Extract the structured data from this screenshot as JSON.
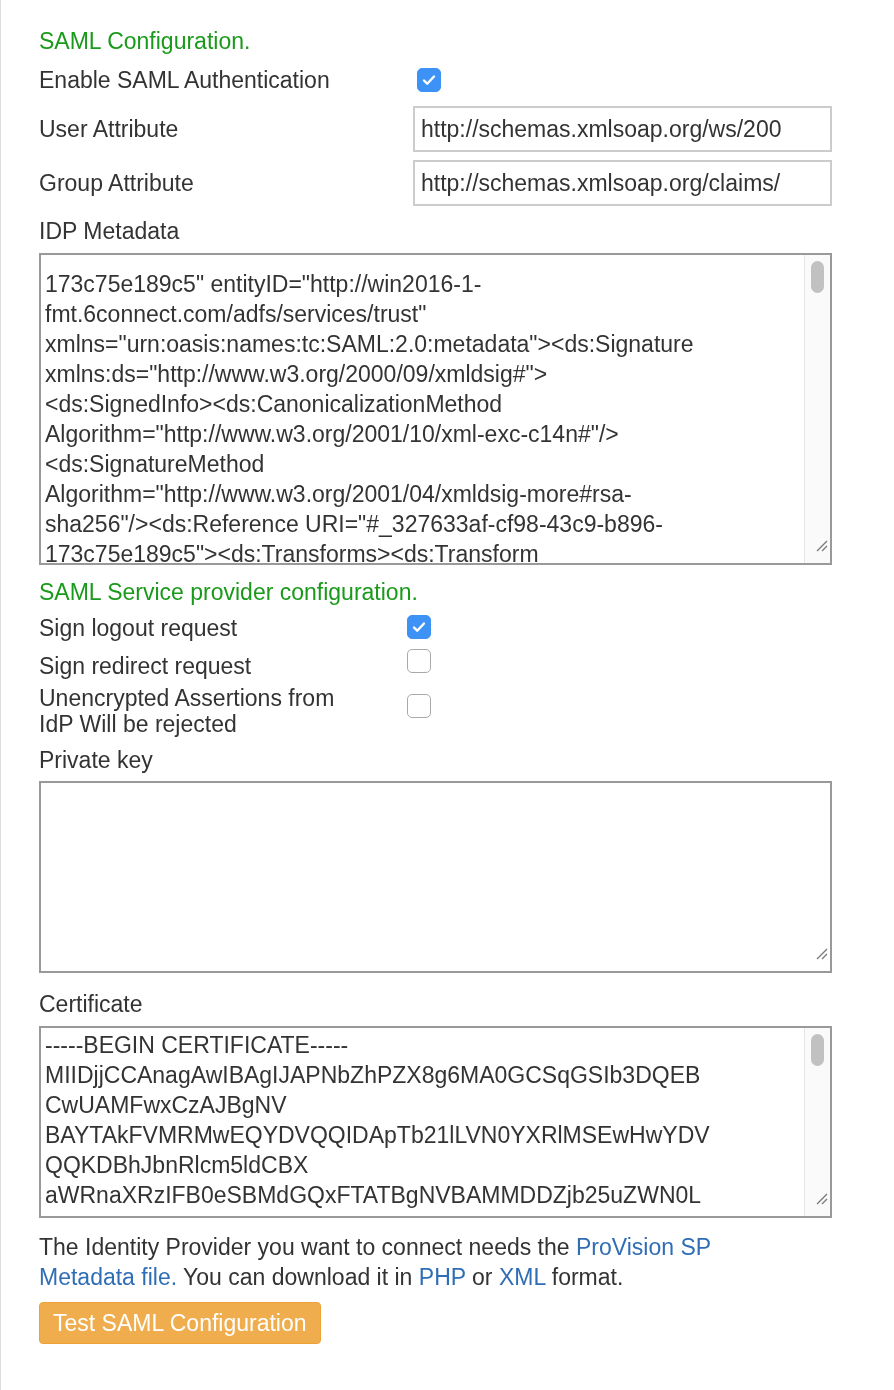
{
  "saml_section": {
    "heading": "SAML Configuration.",
    "enable": {
      "label": "Enable SAML Authentication",
      "checked": true
    },
    "user_attribute": {
      "label": "User Attribute",
      "value": "http://schemas.xmlsoap.org/ws/200"
    },
    "group_attribute": {
      "label": "Group Attribute",
      "value": "http://schemas.xmlsoap.org/claims/"
    },
    "idp_metadata": {
      "label": "IDP Metadata",
      "lines": [
        "173c75e189c5\" entityID=\"http://win2016-1-",
        "fmt.6connect.com/adfs/services/trust\"",
        "xmlns=\"urn:oasis:names:tc:SAML:2.0:metadata\"><ds:Signature",
        "xmlns:ds=\"http://www.w3.org/2000/09/xmldsig#\">",
        "<ds:SignedInfo><ds:CanonicalizationMethod",
        "Algorithm=\"http://www.w3.org/2001/10/xml-exc-c14n#\"/>",
        "<ds:SignatureMethod",
        "Algorithm=\"http://www.w3.org/2001/04/xmldsig-more#rsa-",
        "sha256\"/><ds:Reference URI=\"#_327633af-cf98-43c9-b896-",
        "173c75e189c5\"><ds:Transforms><ds:Transform"
      ]
    }
  },
  "sp_section": {
    "heading": "SAML Service provider configuration.",
    "options": [
      {
        "label": "Sign logout request",
        "checked": true
      },
      {
        "label": "Sign redirect request",
        "checked": false
      },
      {
        "label": "Unencrypted Assertions from IdP Will be rejected",
        "checked": false
      }
    ],
    "private_key": {
      "label": "Private key"
    },
    "certificate": {
      "label": "Certificate",
      "lines": [
        "-----BEGIN CERTIFICATE-----",
        "MIIDjjCCAnagAwIBAgIJAPNbZhPZX8g6MA0GCSqGSIb3DQEB",
        "CwUAMFwxCzAJBgNV",
        "BAYTAkFVMRMwEQYDVQQIDApTb21lLVN0YXRlMSEwHwYDV",
        "QQKDBhJbnRlcm5ldCBX",
        "aWRnaXRzIFB0eSBMdGQxFTATBgNVBAMMDDZjb25uZWN0L"
      ]
    },
    "note": [
      {
        "kind": "text",
        "text": "The Identity Provider you want to connect needs the "
      },
      {
        "kind": "link",
        "text": "ProVision SP"
      },
      {
        "kind": "link",
        "text": "Metadata file."
      },
      {
        "kind": "text",
        "text": " You can download it in "
      },
      {
        "kind": "link",
        "text": "PHP"
      },
      {
        "kind": "text",
        "text": " or "
      },
      {
        "kind": "link",
        "text": "XML"
      },
      {
        "kind": "text",
        "text": " format."
      }
    ],
    "test_button": "Test SAML Configuration"
  }
}
